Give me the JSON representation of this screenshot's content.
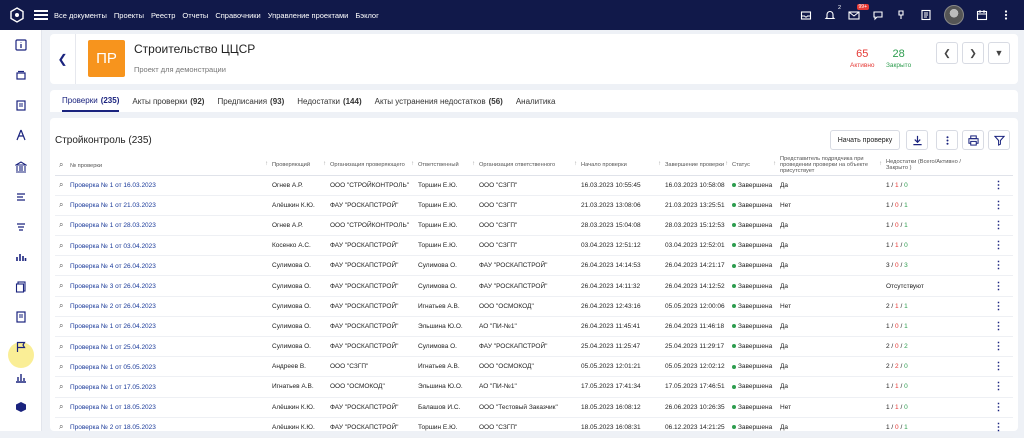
{
  "topnav": [
    "Все документы",
    "Проекты",
    "Реестр",
    "Отчеты",
    "Справочники",
    "Управление проектами",
    "Бэклог"
  ],
  "top_icons": {
    "notifications_count": "2",
    "mail_badge": "99+"
  },
  "project": {
    "badge": "ПР",
    "title": "Строительство ЦЦСР",
    "subtitle": "Проект для демонстрации"
  },
  "stats": {
    "active_value": "65",
    "active_label": "Активно",
    "closed_value": "28",
    "closed_label": "Закрыто"
  },
  "tabs": [
    {
      "label": "Проверки",
      "count": "(235)"
    },
    {
      "label": "Акты проверки",
      "count": "(92)"
    },
    {
      "label": "Предписания",
      "count": "(93)"
    },
    {
      "label": "Недостатки",
      "count": "(144)"
    },
    {
      "label": "Акты устранения недостатков",
      "count": "(56)"
    },
    {
      "label": "Аналитика",
      "count": ""
    }
  ],
  "panel": {
    "title": "Стройконтроль (235)",
    "start_button": "Начать проверку"
  },
  "table": {
    "headers": [
      "№ проверки",
      "Проверяющий",
      "Организация проверяющего",
      "Ответственный",
      "Организация ответственного",
      "Начало проверки",
      "Завершение проверки",
      "Статус",
      "Представитель подрядчика при проведении проверки на объекте присутствует",
      "Недостатки (Всего/Активно / Закрыто )"
    ],
    "rows": [
      {
        "id": "Проверка № 1 от 16.03.2023",
        "inspector": "Огнев А.Р.",
        "insp_org": "ООО \"СТРОЙКОНТРОЛЬ\"",
        "resp": "Торшин Е.Ю.",
        "resp_org": "ООО \"СЗГП\"",
        "start": "16.03.2023 10:55:45",
        "end": "16.03.2023 10:58:08",
        "status": "Завершена",
        "rep": "Да",
        "total": "1",
        "active": "1",
        "closed": "0"
      },
      {
        "id": "Проверка № 1 от 21.03.2023",
        "inspector": "Алёшкин К.Ю.",
        "insp_org": "ФАУ \"РОСКАПСТРОЙ\"",
        "resp": "Торшин Е.Ю.",
        "resp_org": "ООО \"СЗГП\"",
        "start": "21.03.2023 13:08:06",
        "end": "21.03.2023 13:25:51",
        "status": "Завершена",
        "rep": "Нет",
        "total": "1",
        "active": "0",
        "closed": "1"
      },
      {
        "id": "Проверка № 1 от 28.03.2023",
        "inspector": "Огнев А.Р.",
        "insp_org": "ООО \"СТРОЙКОНТРОЛЬ\"",
        "resp": "Торшин Е.Ю.",
        "resp_org": "ООО \"СЗГП\"",
        "start": "28.03.2023 15:04:08",
        "end": "28.03.2023 15:12:53",
        "status": "Завершена",
        "rep": "Да",
        "total": "1",
        "active": "0",
        "closed": "1"
      },
      {
        "id": "Проверка № 1 от 03.04.2023",
        "inspector": "Косенко А.С.",
        "insp_org": "ФАУ \"РОСКАПСТРОЙ\"",
        "resp": "Торшин Е.Ю.",
        "resp_org": "ООО \"СЗГП\"",
        "start": "03.04.2023 12:51:12",
        "end": "03.04.2023 12:52:01",
        "status": "Завершена",
        "rep": "Да",
        "total": "1",
        "active": "1",
        "closed": "0"
      },
      {
        "id": "Проверка № 4 от 26.04.2023",
        "inspector": "Сулимова О.",
        "insp_org": "ФАУ \"РОСКАПСТРОЙ\"",
        "resp": "Сулимова О.",
        "resp_org": "ФАУ \"РОСКАПСТРОЙ\"",
        "start": "26.04.2023 14:14:53",
        "end": "26.04.2023 14:21:17",
        "status": "Завершена",
        "rep": "Да",
        "total": "3",
        "active": "0",
        "closed": "3"
      },
      {
        "id": "Проверка № 3 от 26.04.2023",
        "inspector": "Сулимова О.",
        "insp_org": "ФАУ \"РОСКАПСТРОЙ\"",
        "resp": "Сулимова О.",
        "resp_org": "ФАУ \"РОСКАПСТРОЙ\"",
        "start": "26.04.2023 14:11:32",
        "end": "26.04.2023 14:12:52",
        "status": "Завершена",
        "rep": "Да",
        "none": "Отсутствуют"
      },
      {
        "id": "Проверка № 2 от 26.04.2023",
        "inspector": "Сулимова О.",
        "insp_org": "ФАУ \"РОСКАПСТРОЙ\"",
        "resp": "Игнатьев А.В.",
        "resp_org": "ООО \"ОСМОКОД\"",
        "start": "26.04.2023 12:43:16",
        "end": "05.05.2023 12:00:06",
        "status": "Завершена",
        "rep": "Нет",
        "total": "2",
        "active": "1",
        "closed": "1"
      },
      {
        "id": "Проверка № 1 от 26.04.2023",
        "inspector": "Сулимова О.",
        "insp_org": "ФАУ \"РОСКАПСТРОЙ\"",
        "resp": "Эльшина Ю.О.",
        "resp_org": "АО \"ПИ-№1\"",
        "start": "26.04.2023 11:45:41",
        "end": "26.04.2023 11:46:18",
        "status": "Завершена",
        "rep": "Да",
        "total": "1",
        "active": "0",
        "closed": "1"
      },
      {
        "id": "Проверка № 1 от 25.04.2023",
        "inspector": "Сулимова О.",
        "insp_org": "ФАУ \"РОСКАПСТРОЙ\"",
        "resp": "Сулимова О.",
        "resp_org": "ФАУ \"РОСКАПСТРОЙ\"",
        "start": "25.04.2023 11:25:47",
        "end": "25.04.2023 11:29:17",
        "status": "Завершена",
        "rep": "Да",
        "total": "2",
        "active": "0",
        "closed": "2"
      },
      {
        "id": "Проверка № 1 от 05.05.2023",
        "inspector": "Андреев В.",
        "insp_org": "ООО \"СЗГП\"",
        "resp": "Игнатьев А.В.",
        "resp_org": "ООО \"ОСМОКОД\"",
        "start": "05.05.2023 12:01:21",
        "end": "05.05.2023 12:02:12",
        "status": "Завершена",
        "rep": "Да",
        "total": "2",
        "active": "2",
        "closed": "0"
      },
      {
        "id": "Проверка № 1 от 17.05.2023",
        "inspector": "Игнатьев А.В.",
        "insp_org": "ООО \"ОСМОКОД\"",
        "resp": "Эльшина Ю.О.",
        "resp_org": "АО \"ПИ-№1\"",
        "start": "17.05.2023 17:41:34",
        "end": "17.05.2023 17:46:51",
        "status": "Завершена",
        "rep": "Да",
        "total": "1",
        "active": "1",
        "closed": "0"
      },
      {
        "id": "Проверка № 1 от 18.05.2023",
        "inspector": "Алёшкин К.Ю.",
        "insp_org": "ФАУ \"РОСКАПСТРОЙ\"",
        "resp": "Балашов И.С.",
        "resp_org": "ООО \"Тестовый Заказчик\"",
        "start": "18.05.2023 16:08:12",
        "end": "26.06.2023 10:26:35",
        "status": "Завершена",
        "rep": "Нет",
        "total": "1",
        "active": "1",
        "closed": "0"
      },
      {
        "id": "Проверка № 2 от 18.05.2023",
        "inspector": "Алёшкин К.Ю.",
        "insp_org": "ФАУ \"РОСКАПСТРОЙ\"",
        "resp": "Торшин Е.Ю.",
        "resp_org": "ООО \"СЗГП\"",
        "start": "18.05.2023 16:08:31",
        "end": "06.12.2023 14:21:25",
        "status": "Завершена",
        "rep": "Да",
        "total": "1",
        "active": "0",
        "closed": "1"
      }
    ]
  }
}
